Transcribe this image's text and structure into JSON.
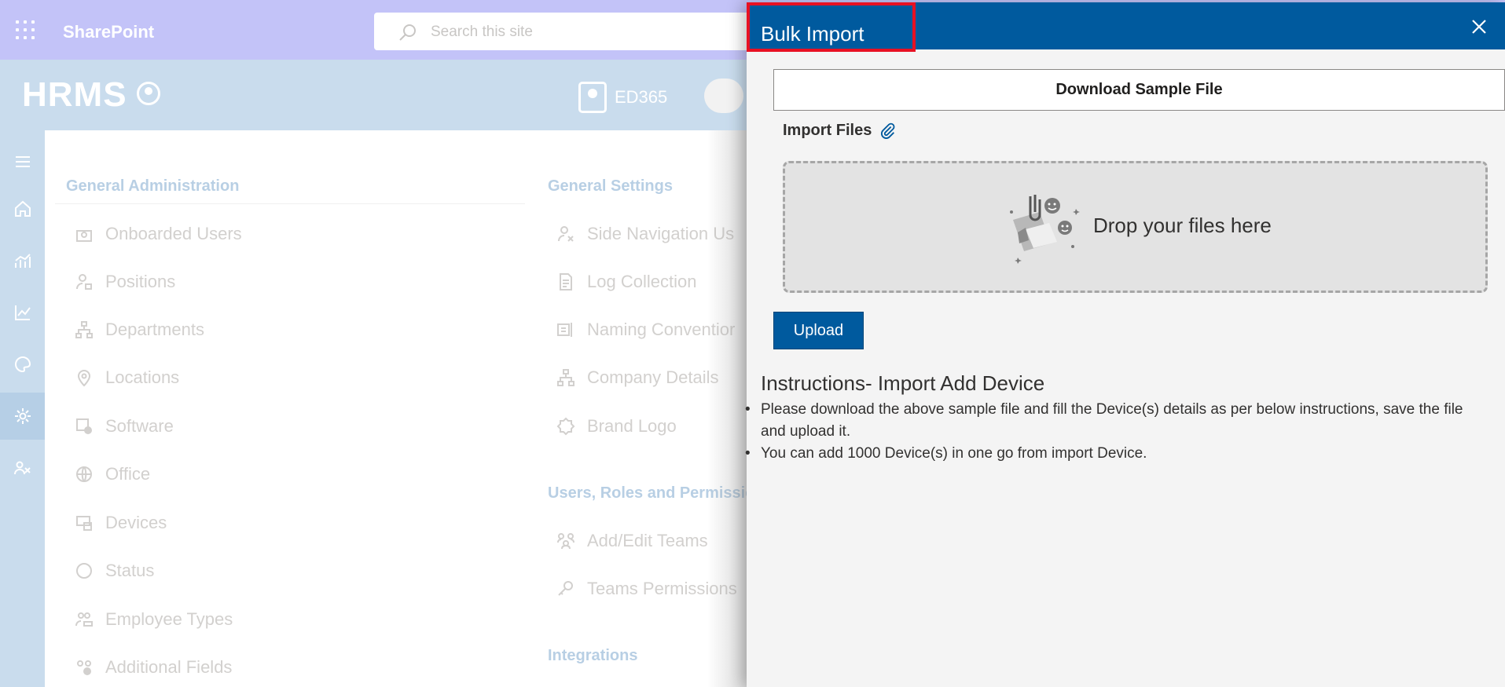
{
  "topbar": {
    "brand": "SharePoint",
    "search_placeholder": "Search this site"
  },
  "hrms": {
    "logo_text": "HRMS",
    "ed365_label": "ED365"
  },
  "left_rail": {
    "items": [
      {
        "icon": "hamburger-icon"
      },
      {
        "icon": "home-icon"
      },
      {
        "icon": "analytics-icon"
      },
      {
        "icon": "trend-chart-icon"
      },
      {
        "icon": "palette-icon"
      },
      {
        "icon": "settings-icon",
        "active": true
      },
      {
        "icon": "people-icon"
      }
    ]
  },
  "general_administration": {
    "title": "General Administration",
    "items": [
      {
        "label": "Onboarded Users",
        "icon": "onboarded-users-icon"
      },
      {
        "label": "Positions",
        "icon": "positions-icon"
      },
      {
        "label": "Departments",
        "icon": "departments-icon"
      },
      {
        "label": "Locations",
        "icon": "location-pin-icon"
      },
      {
        "label": "Software",
        "icon": "software-icon"
      },
      {
        "label": "Office",
        "icon": "globe-icon"
      },
      {
        "label": "Devices",
        "icon": "devices-icon"
      },
      {
        "label": "Status",
        "icon": "status-circle-icon"
      },
      {
        "label": "Employee Types",
        "icon": "employee-types-icon"
      },
      {
        "label": "Additional Fields",
        "icon": "additional-fields-icon"
      }
    ]
  },
  "general_settings": {
    "title": "General Settings",
    "items": [
      {
        "label": "Side Navigation Us",
        "icon": "side-navigation-icon"
      },
      {
        "label": "Log Collection",
        "icon": "log-collection-icon"
      },
      {
        "label": "Naming Conventior",
        "icon": "naming-convention-icon"
      },
      {
        "label": "Company Details",
        "icon": "company-details-icon"
      },
      {
        "label": "Brand Logo",
        "icon": "brand-logo-icon"
      }
    ]
  },
  "users_roles": {
    "title": "Users, Roles and Permissio",
    "items": [
      {
        "label": "Add/Edit Teams",
        "icon": "teams-icon"
      },
      {
        "label": "Teams Permissions",
        "icon": "key-icon"
      }
    ]
  },
  "integrations": {
    "title": "Integrations"
  },
  "panel": {
    "title": "Bulk Import",
    "download_button": "Download Sample File",
    "import_files_label": "Import Files",
    "dropzone_text": "Drop your files here",
    "upload_button": "Upload",
    "instructions_title": "Instructions- Import Add Device",
    "instructions": [
      "Please download the above sample file and fill the Device(s) details as per below instructions, save the file and upload it.",
      "You can add 1000 Device(s) in one go from import Device."
    ]
  },
  "colors": {
    "panel_header": "#005a9e",
    "highlight": "#e81123",
    "suite_bar": "#c3c3f8",
    "hrms_header": "#c9dced"
  }
}
